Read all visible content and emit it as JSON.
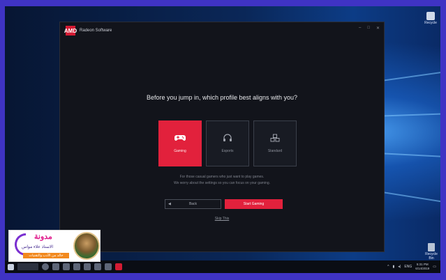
{
  "app": {
    "title": "Radeon Software",
    "logo": "AMD"
  },
  "window_controls": {
    "minimize": "–",
    "maximize": "□",
    "close": "✕"
  },
  "onboarding": {
    "question": "Before you jump in, which profile best aligns with you?",
    "profiles": [
      {
        "label": "Gaming",
        "icon": "gamepad-icon",
        "selected": true
      },
      {
        "label": "Esports",
        "icon": "headset-icon",
        "selected": false
      },
      {
        "label": "Standard",
        "icon": "cubes-icon",
        "selected": false
      }
    ],
    "description_line1": "For those casual gamers who just want to play games.",
    "description_line2": "We worry about the settings so you can focus on your gaming.",
    "back_label": "Back",
    "start_label": "Start Gaming",
    "skip_label": "Skip This"
  },
  "desktop": {
    "top_icon_label": "Recycle",
    "bin_icon_label": "Recycle Bin"
  },
  "taskbar": {
    "tray_lang": "ENG",
    "clock_time": "5:31 PM",
    "clock_date": "6/14/2019"
  },
  "blog_badge": {
    "title": "مدونة",
    "subtitle": "الاستاذ علاء مواس",
    "tagline": "خالد من الأدب والتقنيات"
  },
  "colors": {
    "accent": "#e2213c",
    "app_bg": "#12141b",
    "border_frame": "#3f33c4"
  }
}
